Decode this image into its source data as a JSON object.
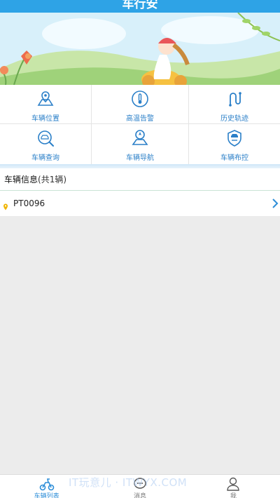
{
  "header": {
    "title": "车行安"
  },
  "features": [
    {
      "label": "车辆位置",
      "icon": "map-pin-icon"
    },
    {
      "label": "高温告警",
      "icon": "thermometer-icon"
    },
    {
      "label": "历史轨迹",
      "icon": "route-icon"
    },
    {
      "label": "车辆查询",
      "icon": "car-search-icon"
    },
    {
      "label": "车辆导航",
      "icon": "navigation-icon"
    },
    {
      "label": "车辆布控",
      "icon": "shield-control-icon"
    }
  ],
  "vehicle_section": {
    "title": "车辆信息",
    "count": "(共1辆)"
  },
  "vehicles": [
    {
      "plate": "PT0096"
    }
  ],
  "tabs": [
    {
      "label": "车辆列表",
      "icon": "scooter-icon",
      "active": true
    },
    {
      "label": "消息",
      "icon": "chat-bubble-icon",
      "active": false
    },
    {
      "label": "我",
      "icon": "user-icon",
      "active": false
    }
  ],
  "watermark": "IT玩意儿 · ITWYX.COM",
  "colors": {
    "accent": "#2ea3e6",
    "label": "#2a7fc8",
    "active_tab": "#2e8ed8"
  }
}
